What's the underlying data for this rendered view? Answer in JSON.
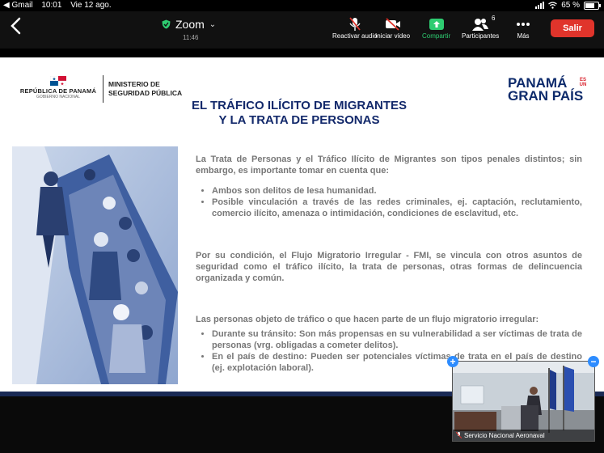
{
  "status_bar": {
    "back_app": "◀ Gmail",
    "time": "10:01",
    "date": "Vie 12 ago.",
    "battery": "65 %"
  },
  "toolbar": {
    "meeting_title": "Zoom",
    "timer": "11:46",
    "buttons": [
      {
        "label": "Reactivar audio",
        "icon": "mic-muted-icon"
      },
      {
        "label": "Iniciar vídeo",
        "icon": "video-off-icon"
      },
      {
        "label": "Compartir",
        "icon": "share-screen-icon"
      },
      {
        "label": "Participantes",
        "icon": "participants-icon",
        "count": "6"
      },
      {
        "label": "Más",
        "icon": "more-dots-icon"
      }
    ],
    "leave_label": "Salir",
    "colors": {
      "share": "#2ecc71",
      "leave": "#e0342b",
      "secure": "#2ecc71"
    }
  },
  "slide": {
    "gov_name": "REPÚBLICA DE PANAMÁ",
    "gov_sub": "GOBIERNO NACIONAL",
    "ministry": "MINISTERIO DE SEGURIDAD PÚBLICA",
    "brand_line1": "PANAMÁ",
    "brand_line2": "GRAN PAÍS",
    "brand_es": "ES",
    "brand_un": "UN",
    "title_line1": "EL TRÁFICO ILÍCITO DE MIGRANTES",
    "title_line2": "Y LA TRATA DE PERSONAS",
    "p1": "La Trata de Personas y el Tráfico Ilícito de Migrantes son tipos penales distintos; sin embargo, es importante tomar en cuenta que:",
    "list1": [
      "Ambos son delitos de lesa humanidad.",
      "Posible vinculación a través de las redes criminales, ej. captación, reclutamiento, comercio ilícito, amenaza o intimidación, condiciones de esclavitud, etc."
    ],
    "p2": "Por su condición, el Flujo Migratorio Irregular - FMI, se vincula con otros asuntos de seguridad como el tráfico ilícito, la trata de personas, otras formas de delincuencia organizada y común.",
    "p3": "Las personas objeto de tráfico o que hacen parte de un flujo migratorio irregular:",
    "list2": [
      "Durante su tránsito: Son más propensas en su vulnerabilidad a ser víctimas de trata de personas (vrg. obligadas a cometer delitos).",
      "En el país de destino: Pueden ser potenciales víctimas de trata en el país de destino (ej. explotación laboral)."
    ]
  },
  "video_tile": {
    "participant_name": "Servicio Nacional Aeronaval"
  }
}
